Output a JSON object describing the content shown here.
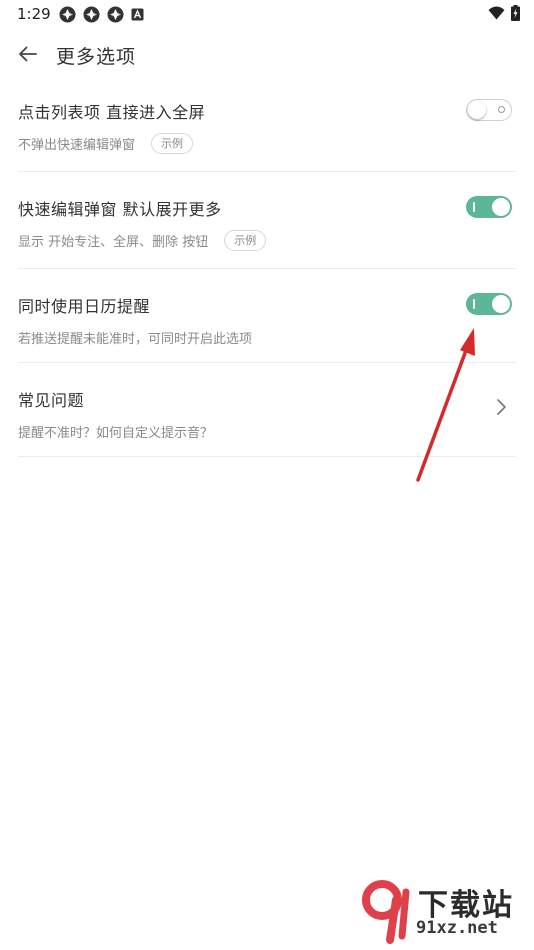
{
  "status_bar": {
    "time": "1:29",
    "left_icons": [
      "app-notification-icon",
      "app-notification-icon",
      "app-notification-icon",
      "a-notification-icon"
    ],
    "right_icons": [
      "wifi-icon",
      "battery-charging-icon"
    ]
  },
  "header": {
    "back_icon": "arrow-left-icon",
    "title": "更多选项"
  },
  "settings": [
    {
      "title": "点击列表项 直接进入全屏",
      "subtitle": "不弹出快速编辑弹窗",
      "example_label": "示例",
      "toggle_on": false
    },
    {
      "title": "快速编辑弹窗 默认展开更多",
      "subtitle": "显示 开始专注、全屏、删除 按钮",
      "example_label": "示例",
      "toggle_on": true
    },
    {
      "title": "同时使用日历提醒",
      "subtitle": "若推送提醒未能准时，可同时开启此选项",
      "toggle_on": true
    },
    {
      "title": "常见问题",
      "subtitle": "提醒不准时？如何自定义提示音？",
      "chevron_icon": "chevron-right-icon"
    }
  ],
  "colors": {
    "toggle_on": "#5cb69a",
    "annotation_arrow": "#d42a2a"
  },
  "watermark": {
    "logo_text": "下载站",
    "url": "91xz.net"
  }
}
